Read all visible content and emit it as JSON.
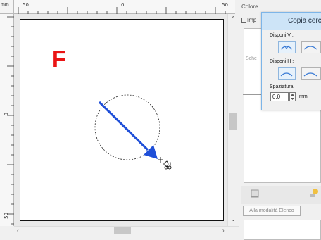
{
  "ruler": {
    "units_corner": "mm",
    "top_ticks": [
      "50",
      "0",
      "50"
    ],
    "left_ticks": [
      "0",
      "50"
    ]
  },
  "canvas": {
    "letter": "F",
    "letter_color": "#ea1414",
    "arrow_color": "#1f4fd8"
  },
  "panel": {
    "colore_label": "Colore",
    "impostazioni_tab": "Imp",
    "scheda_label": "Sche",
    "list_button_label": "Alla modalità Elenco"
  },
  "dialog": {
    "title": "Copia cerc",
    "dispon_v_label": "Disponi V :",
    "dispon_h_label": "Disponi H :",
    "spacing_label": "Spaziatura:",
    "spacing_value": "0.0",
    "spacing_unit": "mm"
  },
  "icons": {
    "scroll_up": "chevron-up-icon",
    "scroll_down": "chevron-down-icon",
    "scroll_left": "chevron-left-icon",
    "scroll_right": "chevron-right-icon",
    "cursor": "move-cursor-icon"
  }
}
